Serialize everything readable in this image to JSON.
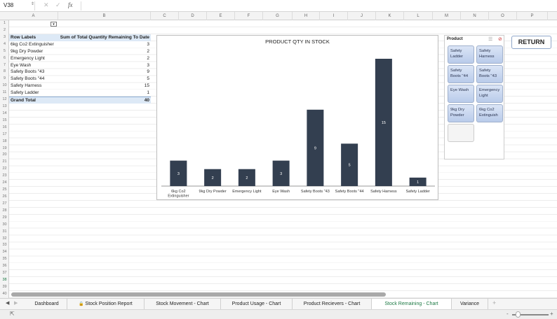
{
  "formula_bar": {
    "name_box": "V38",
    "fx": "fx"
  },
  "columns": [
    "A",
    "B",
    "C",
    "D",
    "E",
    "F",
    "G",
    "H",
    "I",
    "J",
    "K",
    "L",
    "M",
    "N",
    "O",
    "P"
  ],
  "pivot": {
    "header_rows": "Row Labels",
    "header_value": "Sum of Total Quantity Remaining To Date",
    "rows": [
      {
        "label": "6kg Co2 Extinguisher",
        "value": "3"
      },
      {
        "label": "9kg Dry Powder",
        "value": "2"
      },
      {
        "label": "Emergency Light",
        "value": "2"
      },
      {
        "label": "Eye Wash",
        "value": "3"
      },
      {
        "label": "Safety Boots ''43",
        "value": "9"
      },
      {
        "label": "Safety Boots ''44",
        "value": "5"
      },
      {
        "label": "Safety Harness",
        "value": "15"
      },
      {
        "label": "Safety Ladder",
        "value": "1"
      }
    ],
    "total_label": "Grand Total",
    "total_value": "40"
  },
  "chart_data": {
    "type": "bar",
    "title": "PRODUCT QTY IN STOCK",
    "categories": [
      "6kg Co2 Extinguisher",
      "9kg Dry Powder",
      "Emergency Light",
      "Eye Wash",
      "Safety Boots ''43",
      "Safety Boots ''44",
      "Safety Harness",
      "Safety Ladder"
    ],
    "values": [
      3,
      2,
      2,
      3,
      9,
      5,
      15,
      1
    ],
    "data_labels": true,
    "grid": false,
    "legend": "none",
    "color": "#333f50",
    "ylim": [
      0,
      15
    ]
  },
  "slicer": {
    "title": "Product",
    "items": [
      "Safety Ladder",
      "Safety Harness",
      "Safety Boots ''44",
      "Safety Boots ''43",
      "Eye Wash",
      "Emergency Light",
      "9kg Dry Powder",
      "6kg Co2 Extinguish"
    ]
  },
  "return_button": "RETURN",
  "tabs": [
    {
      "label": "Dashboard"
    },
    {
      "label": "Stock Position Report"
    },
    {
      "label": "Stock Movement - Chart"
    },
    {
      "label": "Product Usage - Chart"
    },
    {
      "label": "Product Recievers - Chart"
    },
    {
      "label": "Stock Remaining - Chart",
      "active": true
    },
    {
      "label": "Variance"
    }
  ],
  "accent": "#1e7a45"
}
